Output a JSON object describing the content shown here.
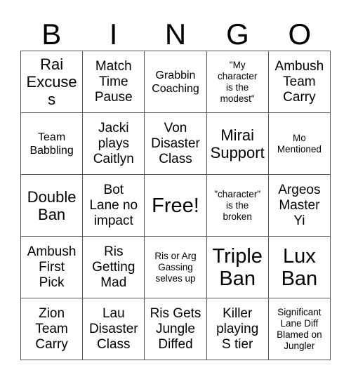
{
  "header": {
    "letters": [
      "B",
      "I",
      "N",
      "G",
      "O"
    ]
  },
  "grid": {
    "rows": 5,
    "columns": 5,
    "free_space": "Free!",
    "cells": [
      {
        "text": "Rai\nExcuses",
        "size": "lg"
      },
      {
        "text": "Match\nTime\nPause",
        "size": "md"
      },
      {
        "text": "Grabbin\nCoaching",
        "size": "sm"
      },
      {
        "text": "\"My\ncharacter\nis the\nmodest\"",
        "size": "xs"
      },
      {
        "text": "Ambush\nTeam\nCarry",
        "size": "md"
      },
      {
        "text": "Team\nBabbling",
        "size": "sm"
      },
      {
        "text": "Jacki\nplays\nCaitlyn",
        "size": "md"
      },
      {
        "text": "Von\nDisaster\nClass",
        "size": "md"
      },
      {
        "text": "Mirai\nSupport",
        "size": "lg"
      },
      {
        "text": "Mo\nMentioned",
        "size": "xs"
      },
      {
        "text": "Double\nBan",
        "size": "lg"
      },
      {
        "text": "Bot\nLane no\nimpact",
        "size": "md"
      },
      {
        "text": "Free!",
        "size": "xl"
      },
      {
        "text": "\"character\"\nis the\nbroken",
        "size": "xs"
      },
      {
        "text": "Argeos\nMaster\nYi",
        "size": "md"
      },
      {
        "text": "Ambush\nFirst\nPick",
        "size": "md"
      },
      {
        "text": "Ris\nGetting\nMad",
        "size": "md"
      },
      {
        "text": "Ris or Arg\nGassing\nselves up",
        "size": "xs"
      },
      {
        "text": "Triple\nBan",
        "size": "xl"
      },
      {
        "text": "Lux\nBan",
        "size": "xl"
      },
      {
        "text": "Zion\nTeam\nCarry",
        "size": "md"
      },
      {
        "text": "Lau\nDisaster\nClass",
        "size": "md"
      },
      {
        "text": "Ris Gets\nJungle\nDiffed",
        "size": "md"
      },
      {
        "text": "Killer\nplaying\nS tier",
        "size": "md"
      },
      {
        "text": "Significant\nLane Diff\nBlamed on\nJungler",
        "size": "xs"
      }
    ]
  },
  "colors": {
    "background": "#ffffff",
    "text": "#000000",
    "grid_line": "#555555"
  }
}
